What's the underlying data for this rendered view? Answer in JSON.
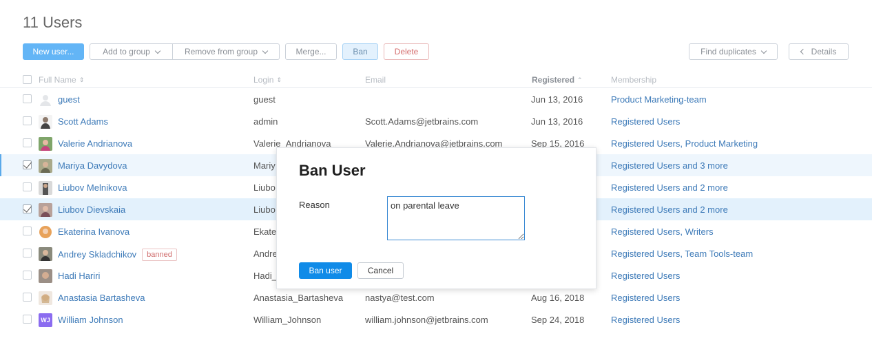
{
  "page": {
    "title": "11 Users"
  },
  "toolbar": {
    "new_user": "New user...",
    "add_to_group": "Add to group",
    "remove_from_group": "Remove from group",
    "merge": "Merge...",
    "ban": "Ban",
    "delete": "Delete",
    "find_duplicates": "Find duplicates",
    "details": "Details"
  },
  "columns": {
    "full_name": "Full Name",
    "login": "Login",
    "email": "Email",
    "registered": "Registered",
    "membership": "Membership"
  },
  "users": [
    {
      "name": "guest",
      "login": "guest",
      "email": "",
      "registered": "Jun 13, 2016",
      "membership": "Product Marketing-team",
      "checked": false
    },
    {
      "name": "Scott Adams",
      "login": "admin",
      "email": "Scott.Adams@jetbrains.com",
      "registered": "Jun 13, 2016",
      "membership": "Registered Users",
      "checked": false
    },
    {
      "name": "Valerie Andrianova",
      "login": "Valerie_Andrianova",
      "email": "Valerie.Andrianova@jetbrains.com",
      "registered": "Sep 15, 2016",
      "membership": "Registered Users, Product Marketing",
      "checked": false
    },
    {
      "name": "Mariya Davydova",
      "login": "Mariy",
      "email": "",
      "registered": "",
      "membership": "Registered Users and 3 more",
      "checked": true
    },
    {
      "name": "Liubov Melnikova",
      "login": "Liubo",
      "email": "",
      "registered": "",
      "membership": "Registered Users and 2 more",
      "checked": false
    },
    {
      "name": "Liubov Dievskaia",
      "login": "Liubo",
      "email": "",
      "registered": "",
      "membership": "Registered Users and 2 more",
      "checked": true
    },
    {
      "name": "Ekaterina Ivanova",
      "login": "Ekate",
      "email": "",
      "registered": "",
      "membership": "Registered Users, Writers",
      "checked": false
    },
    {
      "name": "Andrey Skladchikov",
      "login": "Andre",
      "email": "",
      "registered": "",
      "membership": "Registered Users, Team Tools-team",
      "checked": false,
      "badge": "banned"
    },
    {
      "name": "Hadi Hariri",
      "login": "Hadi_",
      "email": "",
      "registered": "",
      "membership": "Registered Users",
      "checked": false
    },
    {
      "name": "Anastasia Bartasheva",
      "login": "Anastasia_Bartasheva",
      "email": "nastya@test.com",
      "registered": "Aug 16, 2018",
      "membership": "Registered Users",
      "checked": false
    },
    {
      "name": "William Johnson",
      "login": "William_Johnson",
      "email": "william.johnson@jetbrains.com",
      "registered": "Sep 24, 2018",
      "membership": "Registered Users",
      "checked": false,
      "avatar_text": "WJ"
    }
  ],
  "dialog": {
    "title": "Ban User",
    "reason_label": "Reason",
    "reason_value": "on parental leave",
    "ban_button": "Ban user",
    "cancel_button": "Cancel"
  },
  "colors": {
    "accent": "#108be8",
    "link": "#3d7ab8",
    "banned": "#cf6a6a"
  }
}
